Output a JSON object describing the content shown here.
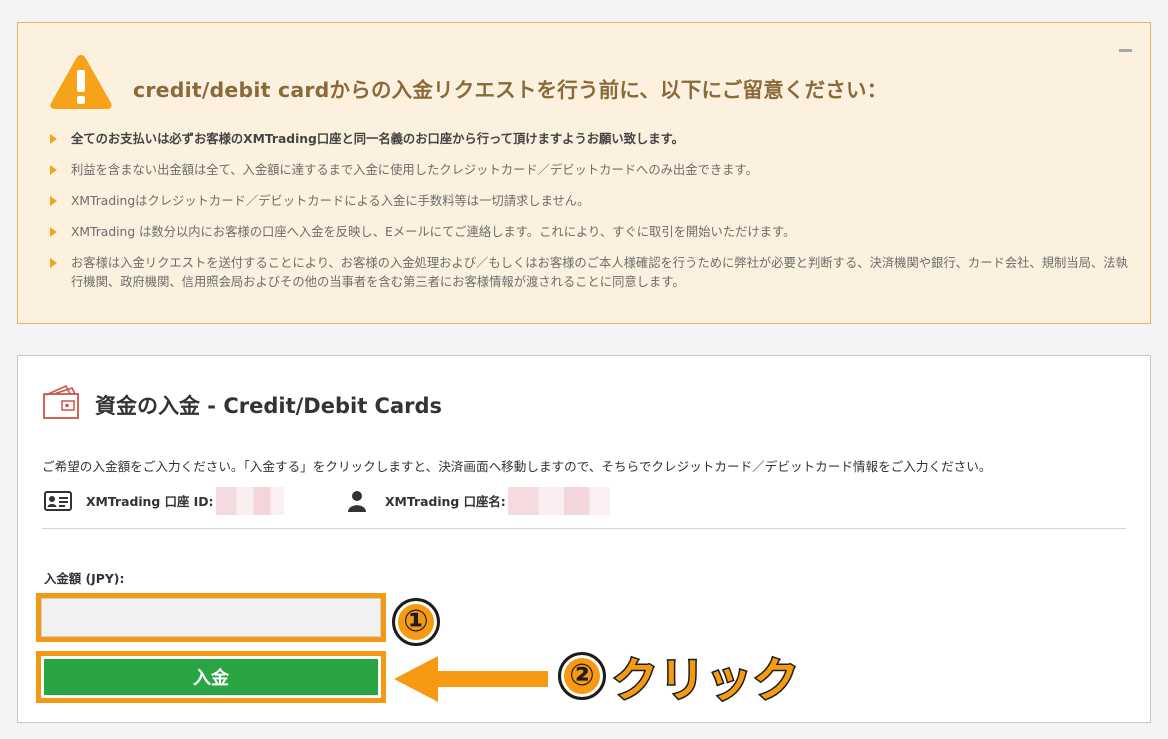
{
  "notice": {
    "title": "credit/debit cardからの入金リクエストを行う前に、以下にご留意ください：",
    "items": [
      "全てのお支払いは必ずお客様のXMTrading口座と同一名義のお口座から行って頂けますようお願い致します。",
      "利益を含まない出金額は全て、入金額に達するまで入金に使用したクレジットカード／デビットカードへのみ出金できます。",
      "XMTradingはクレジットカード／デビットカードによる入金に手数料等は一切請求しません。",
      "XMTrading は数分以内にお客様の口座へ入金を反映し、Eメールにてご連絡します。これにより、すぐに取引を開始いただけます。",
      "お客様は入金リクエストを送付することにより、お客様の入金処理および／もしくはお客様のご本人様確認を行うために弊社が必要と判断する、決済機関や銀行、カード会社、規制当局、法執行機関、政府機関、信用照会局およびその他の当事者を含む第三者にお客様情報が渡されることに同意します。"
    ],
    "accent_color": "#f7a21b"
  },
  "deposit": {
    "heading": "資金の入金 - Credit/Debit Cards",
    "instruction": "ご希望の入金額をご入力ください。「入金する」をクリックしますと、決済画面へ移動しますので、そちらでクレジットカード／デビットカード情報をご入力ください。",
    "account_id_label": "XMTrading 口座 ID:",
    "account_name_label": "XMTrading 口座名:",
    "amount_label": "入金額 (JPY):",
    "amount_value": "",
    "submit_label": "入金",
    "submit_color": "#2aa544"
  },
  "annotations": {
    "step1": "①",
    "step2": "②",
    "step2_text": "クリック",
    "highlight_color": "#f49a12"
  },
  "icons": {
    "warning": "warning-triangle-icon",
    "wallet": "wallet-icon",
    "id_card": "id-card-icon",
    "user": "user-icon",
    "collapse": "minus-icon"
  }
}
